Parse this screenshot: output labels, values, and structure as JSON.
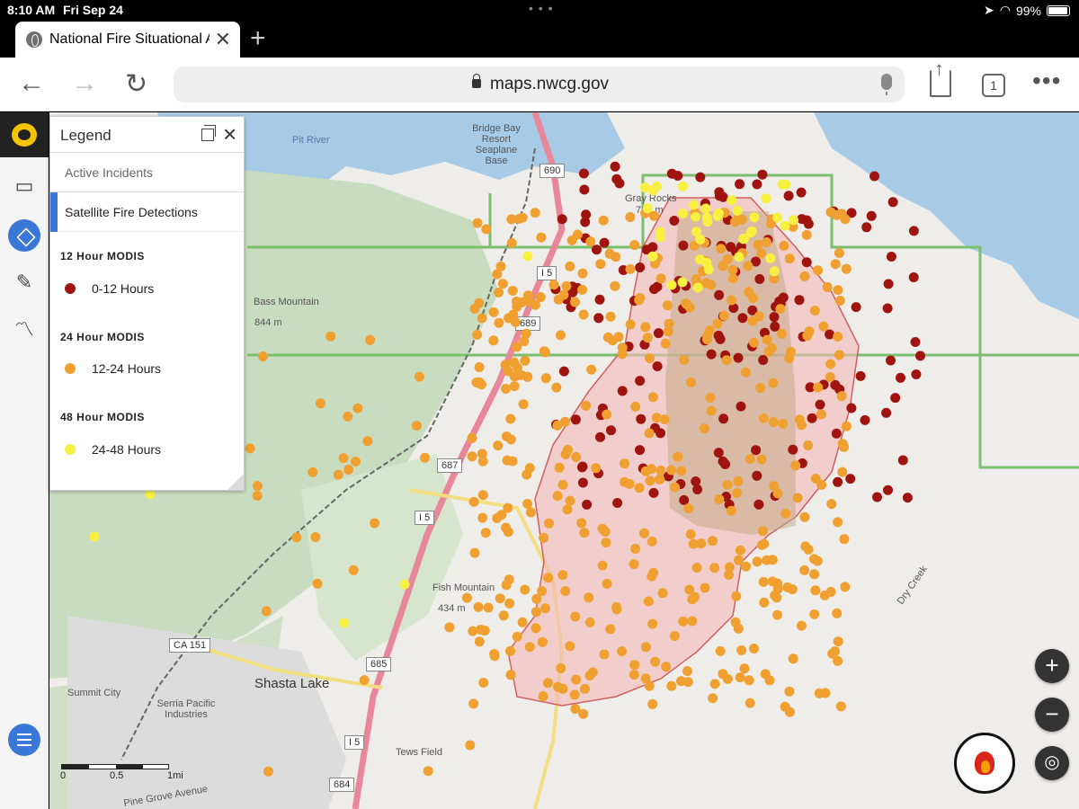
{
  "status": {
    "time": "8:10 AM",
    "date": "Fri Sep 24",
    "battery": "99%"
  },
  "tab": {
    "title": "National Fire Situational Awareness",
    "close": "✕",
    "new_tab": "+"
  },
  "toolbar": {
    "back": "←",
    "forward": "→",
    "reload": "↻",
    "host": "maps.nwcg.gov",
    "tab_count": "1",
    "more": "•••"
  },
  "legend": {
    "title": "Legend",
    "layer_active": "Active Incidents",
    "layer_satellite": "Satellite Fire Detections",
    "groups": [
      {
        "heading": "12 Hour MODIS",
        "label": "0-12 Hours",
        "color": "#a01410"
      },
      {
        "heading": "24 Hour MODIS",
        "label": "12-24 Hours",
        "color": "#f0a030"
      },
      {
        "heading": "48 Hour MODIS",
        "label": "24-48 Hours",
        "color": "#f8f040"
      }
    ]
  },
  "map": {
    "labels": {
      "pit_river": "Pit River",
      "bridge_bay": "Bridge Bay Resort Seaplane Base",
      "gray_rocks": "Gray Rocks",
      "gray_rocks_elev": "723 m",
      "bass_mountain": "Bass Mountain",
      "bass_elev": "844 m",
      "fish_mountain": "Fish Mountain",
      "fish_elev": "434 m",
      "shasta_lake": "Shasta Lake",
      "summit_city": "Summit City",
      "serria": "Serria Pacific Industries",
      "tews_field": "Tews Field",
      "dry_creek": "Dry Creek",
      "pine_grove": "Pine Grove Avenue",
      "ca151": "CA 151"
    },
    "shields": [
      "690",
      "I 5",
      "689",
      "687",
      "I 5",
      "685",
      "I 5",
      "684"
    ],
    "scale": {
      "zero": "0",
      "half": "0.5",
      "one": "1mi"
    },
    "zoom_in": "+",
    "zoom_out": "−"
  }
}
